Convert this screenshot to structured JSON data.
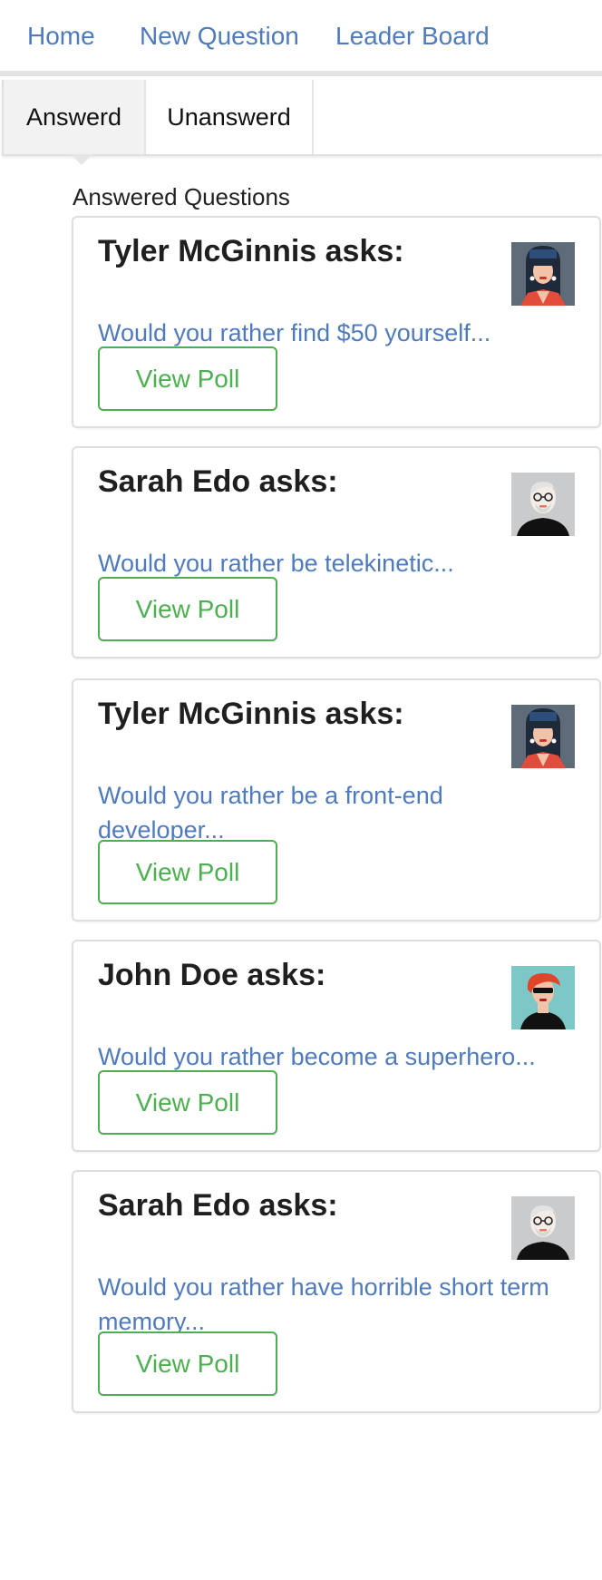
{
  "nav": {
    "home": "Home",
    "new_question": "New Question",
    "leader_board": "Leader Board"
  },
  "tabs": {
    "answered": "Answerd",
    "unanswered": "Unanswerd",
    "active": "answered"
  },
  "section_title": "Answered Questions",
  "cards": [
    {
      "asker": "Tyler McGinnis asks:",
      "question": "Would you rather find $50 yourself...",
      "button": "View Poll",
      "avatar": "woman-long-hair-avatar"
    },
    {
      "asker": "Sarah Edo asks:",
      "question": "Would you rather be telekinetic...",
      "button": "View Poll",
      "avatar": "bald-man-glasses-avatar"
    },
    {
      "asker": "Tyler McGinnis asks:",
      "question": "Would you rather be a front-end developer...",
      "button": "View Poll",
      "avatar": "woman-long-hair-avatar"
    },
    {
      "asker": "John Doe asks:",
      "question": "Would you rather become a superhero...",
      "button": "View Poll",
      "avatar": "red-hair-woman-avatar"
    },
    {
      "asker": "Sarah Edo asks:",
      "question": "Would you rather have horrible short term memory...",
      "button": "View Poll",
      "avatar": "bald-man-glasses-avatar"
    }
  ],
  "colors": {
    "link": "#4f7bbd",
    "button": "#4caf50",
    "active_tab_bg": "#f2f2f2"
  }
}
